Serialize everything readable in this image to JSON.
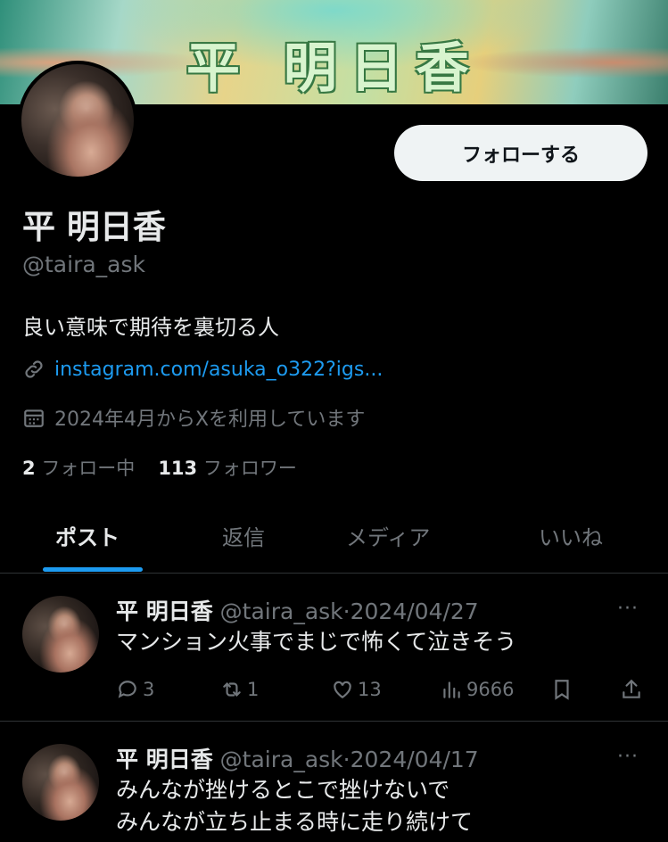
{
  "header": {
    "banner_title": "平 明日香",
    "follow_button": "フォローする"
  },
  "profile": {
    "display_name": "平 明日香",
    "handle": "@taira_ask",
    "bio": "良い意味で期待を裏切る人",
    "link": "instagram.com/asuka_o322?igs...",
    "joined": "2024年4月からXを利用しています",
    "following_count": "2",
    "following_label": "フォロー中",
    "followers_count": "113",
    "followers_label": "フォロワー"
  },
  "tabs": [
    {
      "label": "ポスト",
      "active": true
    },
    {
      "label": "返信",
      "active": false
    },
    {
      "label": "メディア",
      "active": false
    },
    {
      "label": "いいね",
      "active": false
    }
  ],
  "posts": [
    {
      "name": "平 明日香",
      "handle": "@taira_ask",
      "sep": "·",
      "date": "2024/04/27",
      "lines": [
        "マンション火事でまじで怖くて泣きそう"
      ],
      "replies": "3",
      "reposts": "1",
      "likes": "13",
      "views": "9666",
      "more": "···"
    },
    {
      "name": "平 明日香",
      "handle": "@taira_ask",
      "sep": "·",
      "date": "2024/04/17",
      "lines": [
        "みんなが挫けるとこで挫けないで",
        "みんなが立ち止まる時に走り続けて"
      ],
      "more": "···"
    }
  ],
  "colors": {
    "accent": "#1d9bf0",
    "muted": "#71767b",
    "text": "#e7e9ea",
    "background": "#000000"
  }
}
